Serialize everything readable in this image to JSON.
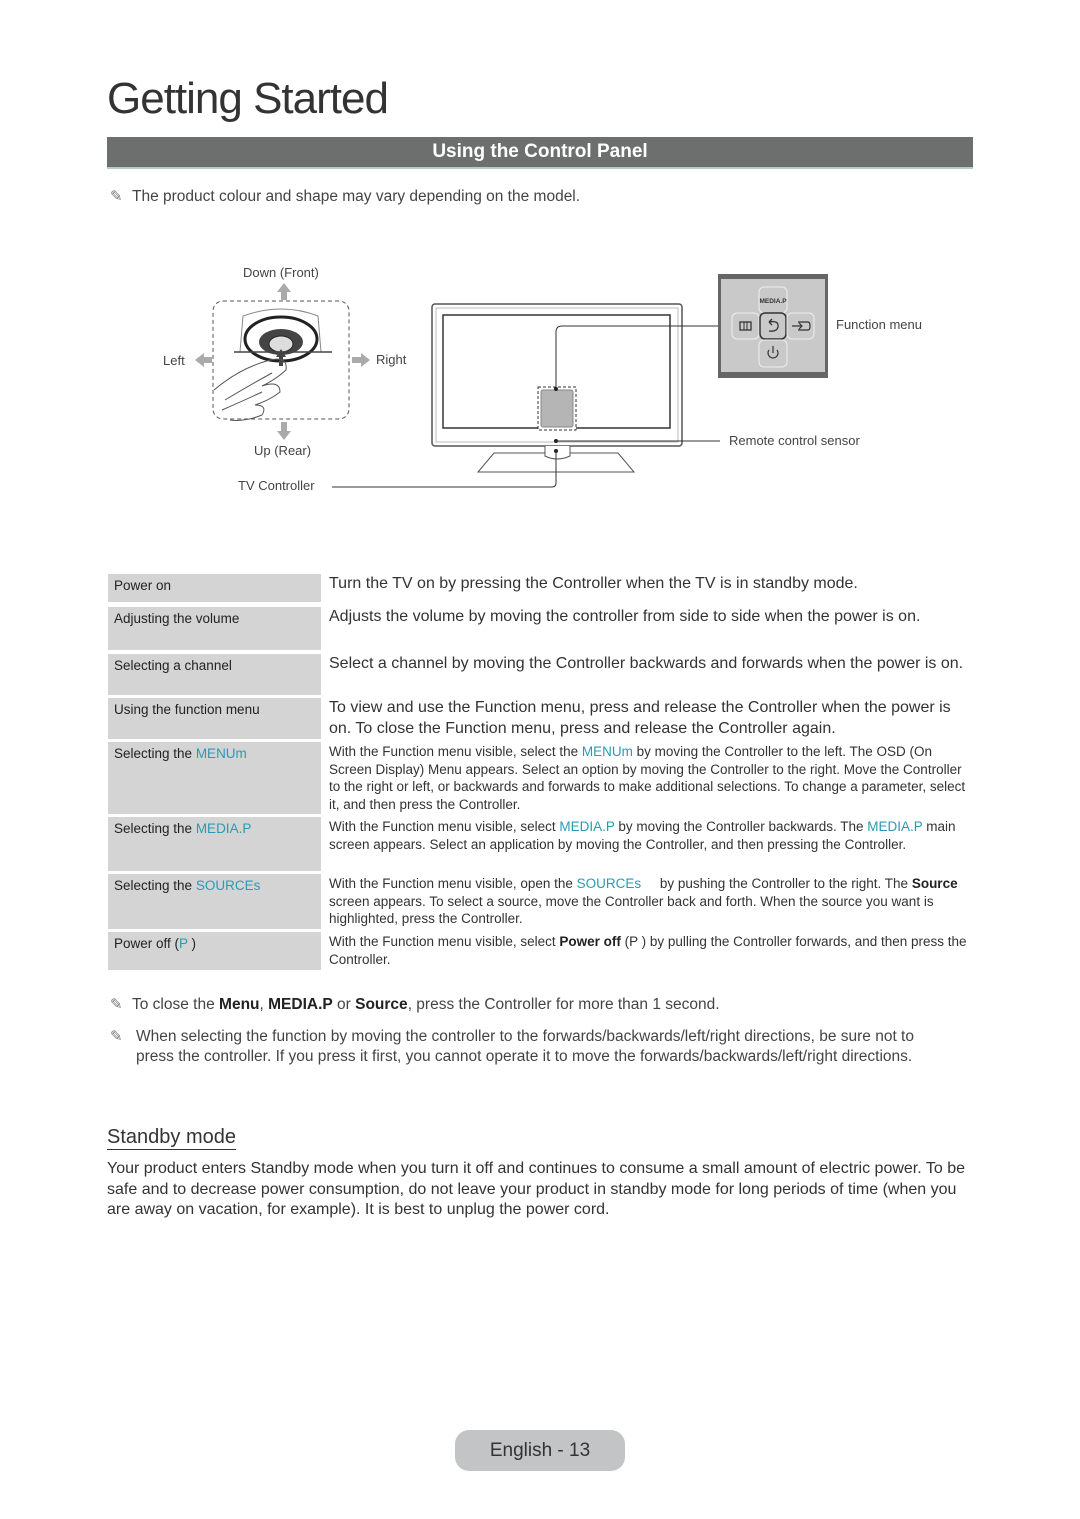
{
  "chapter_title": "Getting Started",
  "section_title": "Using the Control Panel",
  "intro_note": "The product colour and shape may vary depending on the model.",
  "diagram": {
    "directions": {
      "down": "Down (Front)",
      "up": "Up (Rear)",
      "left": "Left",
      "right": "Right"
    },
    "tv_controller_label": "TV Controller",
    "function_menu_label": "Function menu",
    "remote_sensor_label": "Remote control sensor",
    "function_menu_buttons": {
      "top": "MEDIA.P",
      "left_icon": "menu-icon",
      "center_icon": "return-icon",
      "right_icon": "source-icon",
      "bottom_icon": "power-icon"
    }
  },
  "table": {
    "rows": [
      {
        "label": "Power on",
        "desc": "Turn the TV on by pressing the Controller when the TV is in standby mode."
      },
      {
        "label": "Adjusting the volume",
        "desc": "Adjusts the volume by moving the controller from side to side when the power is on."
      },
      {
        "label": "Selecting a channel",
        "desc": "Select a channel by moving the Controller backwards and forwards when the power is on."
      },
      {
        "label": "Using the function menu",
        "desc": "To view and use the Function menu, press and release the Controller when the power is on. To close the Function menu, press and release the Controller again."
      },
      {
        "label_prefix": "Selecting the ",
        "label_hl": "MENUm",
        "desc_a": "With the Function menu visible, select the ",
        "desc_hl": "MENUm",
        "desc_b": "  by moving the Controller to the left. The OSD (On Screen Display) Menu appears. Select an option by moving the Controller to the right. Move the Controller to the right or left, or backwards and forwards to make additional selections. To change a parameter, select it, and then press the Controller."
      },
      {
        "label_prefix": "Selecting the ",
        "label_hl": "MEDIA.P",
        "desc_a": "With the Function menu visible, select ",
        "desc_hl": "MEDIA.P",
        "desc_b": " by moving the Controller backwards. The ",
        "desc_hl2": "MEDIA.P",
        "desc_c": " main screen appears. Select an application by moving the Controller, and then pressing the Controller."
      },
      {
        "label_prefix": "Selecting the ",
        "label_hl": "SOURCEs",
        "desc_a": "With the Function menu visible, open the ",
        "desc_hl": "SOURCEs",
        "desc_b": "     by pushing the Controller to the right. The ",
        "desc_bold": "Source",
        "desc_c": " screen appears. To select a source, move the Controller back and forth. When the source you want is highlighted, press the Controller."
      },
      {
        "label_prefix": "Power off (",
        "label_hl": "P",
        "label_suffix": " )",
        "desc_a": "With the Function menu visible, select ",
        "desc_bold": "Power off",
        "desc_b": " (P ) by pulling the Controller forwards, and then press the Controller."
      }
    ]
  },
  "notes": {
    "close_note": {
      "a": "To close the ",
      "b1": "Menu",
      "c": ", ",
      "b2": "MEDIA.P",
      "d": " or ",
      "b3": "Source",
      "e": ", press the Controller for more than 1 second."
    },
    "direction_note": "When selecting the function by moving the controller to the forwards/backwards/left/right directions, be sure not to press the controller. If you press it first, you cannot operate it to move the forwards/backwards/left/right directions."
  },
  "standby": {
    "title": "Standby mode",
    "body": "Your product enters Standby mode when you turn it off and continues to consume a small amount of electric power. To be safe and to decrease power consumption, do not leave your product in standby mode for long periods of time (when you are away on vacation, for example). It is best to unplug the power cord."
  },
  "page_footer": "English - 13",
  "colors": {
    "section_bar": "#6d6e6e",
    "highlight": "#2a9ab3",
    "table_label_bg": "#d4d4d5",
    "footer_badge": "#c3c4c5"
  }
}
